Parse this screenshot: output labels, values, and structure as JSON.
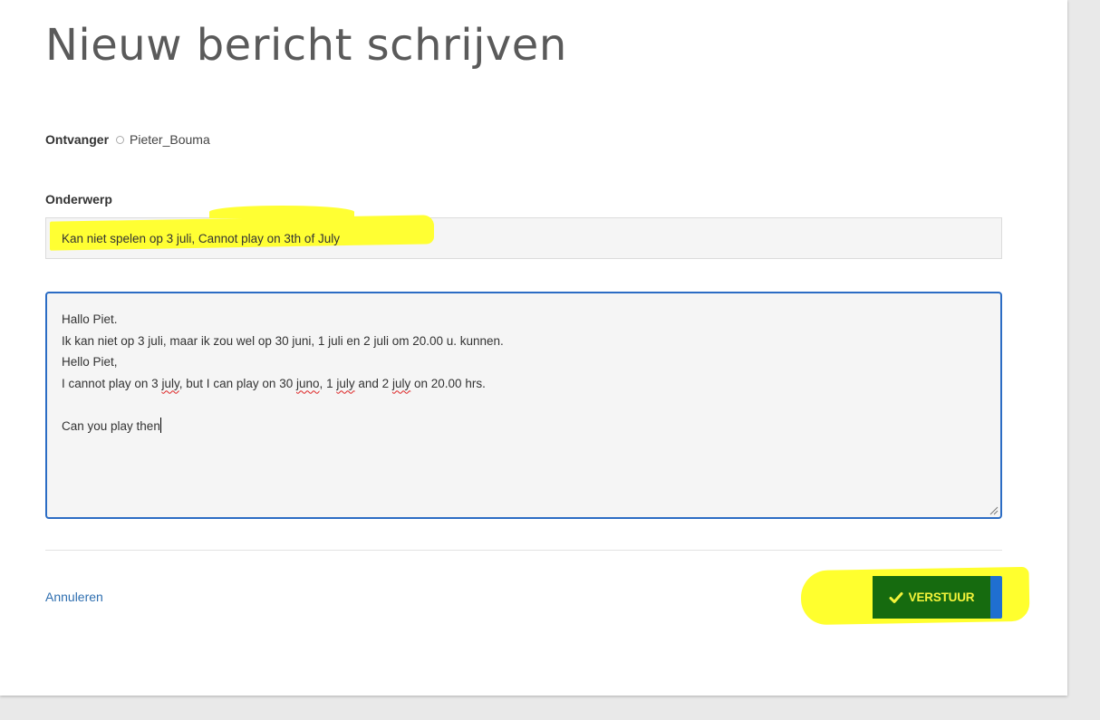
{
  "page": {
    "title": "Nieuw bericht schrijven"
  },
  "recipient": {
    "label": "Ontvanger",
    "name": "Pieter_Bouma"
  },
  "subject": {
    "label": "Onderwerp",
    "value": "Kan niet spelen op 3 juli, Cannot play on 3th of July"
  },
  "message": {
    "lines": [
      "Hallo Piet.",
      "Ik kan niet op 3 juli, maar ik zou wel op 30 juni, 1 juli en 2 juli om 20.00 u. kunnen.",
      "Hello Piet,",
      "I cannot play on 3 july, but I can play on 30 juno, 1 july and 2 july on 20.00 hrs.",
      "",
      "Can you play then"
    ]
  },
  "actions": {
    "cancel_label": "Annuleren",
    "send_label": "VERSTUUR"
  },
  "colors": {
    "highlight": "#ffff33",
    "send_button": "#166b0f",
    "send_text": "#f4f43a",
    "focus_border": "#2b6cc4",
    "link": "#2f6fb0"
  },
  "icons": {
    "recipient": "radio-circle-icon",
    "send": "check-icon",
    "resize": "resize-grip-icon"
  }
}
